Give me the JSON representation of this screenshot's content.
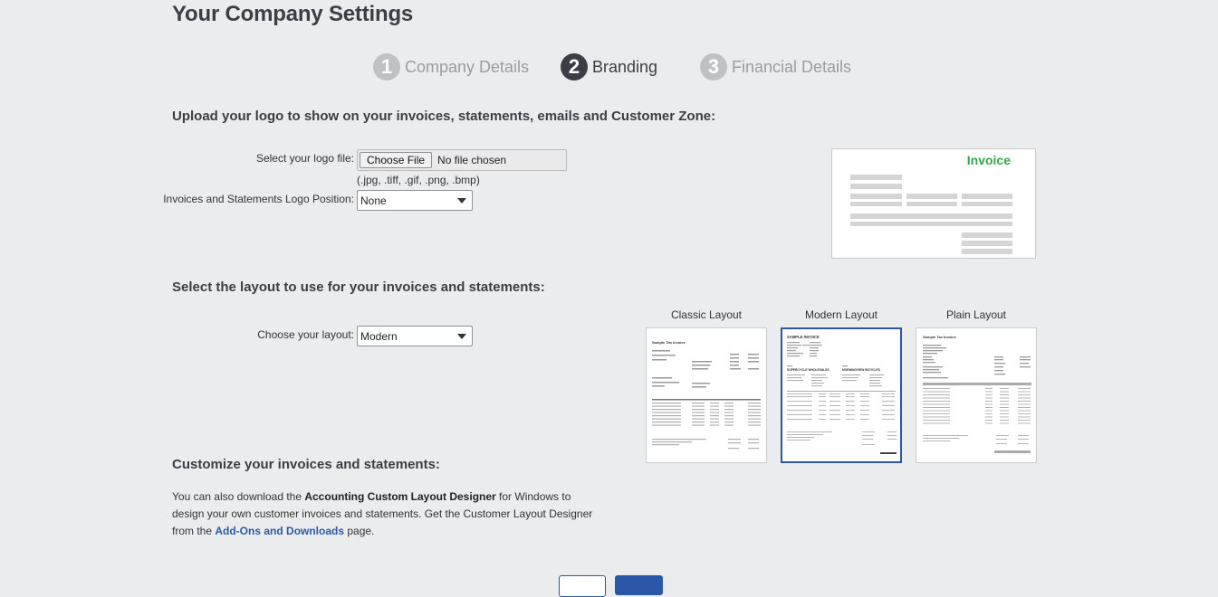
{
  "page": {
    "title": "Your Company Settings"
  },
  "steps": [
    {
      "number": "1",
      "label": "Company Details",
      "state": "inactive"
    },
    {
      "number": "2",
      "label": "Branding",
      "state": "active"
    },
    {
      "number": "3",
      "label": "Financial Details",
      "state": "inactive"
    }
  ],
  "logo_section": {
    "heading": "Upload your logo to show on your invoices, statements, emails and Customer Zone:",
    "file_label": "Select your logo file:",
    "choose_button": "Choose File",
    "file_status": "No file chosen",
    "file_hint": "(.jpg, .tiff, .gif, .png, .bmp)",
    "position_label": "Invoices and Statements Logo Position:",
    "position_value": "None",
    "preview_title": "Invoice"
  },
  "layout_section": {
    "heading": "Select the layout to use for your invoices and statements:",
    "choose_label": "Choose your layout:",
    "layout_value": "Modern",
    "layouts": [
      {
        "label": "Classic Layout",
        "doc_title": "Sample Tax Invoice"
      },
      {
        "label": "Modern Layout",
        "doc_title": "SAMPLE INVOICE",
        "supplier": "SUPERCYCLE WHOLESALES",
        "customer": "MORNINGVIEW BICYCLES"
      },
      {
        "label": "Plain Layout",
        "doc_title": "Sample Tax Invoice"
      }
    ],
    "selected_layout": "Modern Layout"
  },
  "customize_section": {
    "heading": "Customize your invoices and statements:",
    "text_1": "You can also download the ",
    "bold_1": "Accounting Custom Layout Designer",
    "text_2": " for Windows to design your own customer invoices and statements. Get the Customer Layout Designer from the ",
    "link": "Add-Ons and Downloads",
    "text_3": " page."
  },
  "colors": {
    "accent": "#2c56a8",
    "invoice_green": "#32a84a",
    "background": "#ebeced"
  }
}
